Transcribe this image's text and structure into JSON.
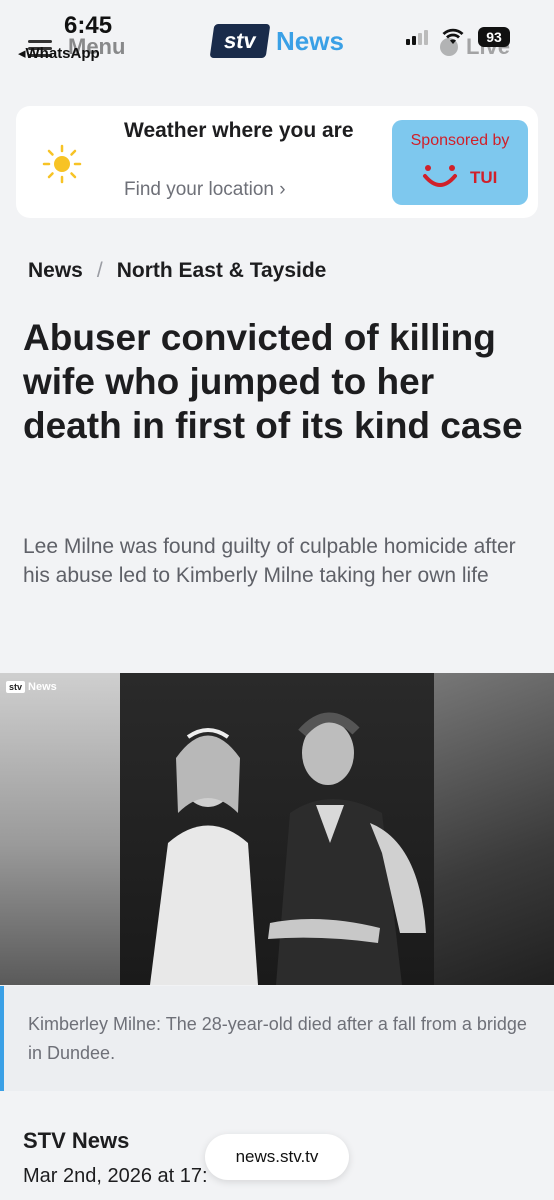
{
  "status_bar": {
    "time": "6:45",
    "back_app": "◂WhatsApp",
    "battery": "93"
  },
  "header": {
    "menu_label": "Menu",
    "logo_stv": "stv",
    "logo_news": "News",
    "live_label": "Live"
  },
  "weather": {
    "title": "Weather where you are",
    "link": "Find your location ›",
    "sponsor_label": "Sponsored by",
    "sponsor_brand": "TUI"
  },
  "breadcrumb": {
    "section": "News",
    "separator": "/",
    "subsection": "North East & Tayside"
  },
  "article": {
    "headline": "Abuser convicted of killing wife who jumped to her death in first of its kind case",
    "standfirst": "Lee Milne was found guilty of culpable homicide after his abuse led to Kimberly Milne taking her own life",
    "image_watermark": "News",
    "image_watermark_stv": "stv",
    "caption": "Kimberley Milne: The 28-year-old died after a fall from a bridge in Dundee.",
    "author": "STV News",
    "date": "Mar 2nd, 2026 at 17:"
  },
  "browser": {
    "url": "news.stv.tv"
  },
  "colors": {
    "accent": "#3aa0e6",
    "brand_navy": "#1a2b4a",
    "sponsor_bg": "#7ec8ee",
    "sponsor_red": "#d0202a"
  }
}
